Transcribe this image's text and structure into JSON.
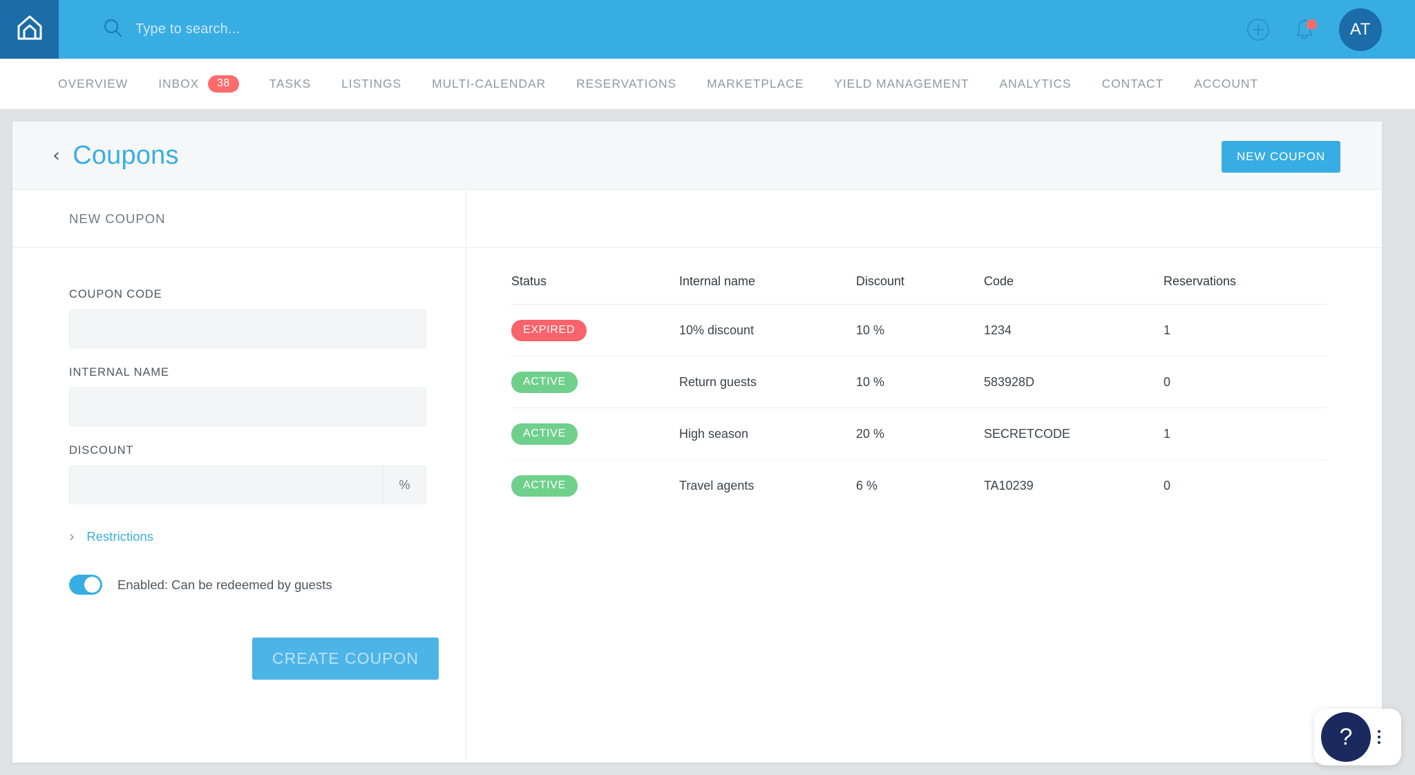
{
  "header": {
    "logo_icon": "house-logo-icon",
    "search": {
      "icon": "search-icon",
      "placeholder": "Type to search...",
      "value": ""
    },
    "add_icon": "plus-circle-icon",
    "notifications_icon": "bell-icon",
    "notifications_has_alert": true,
    "avatar_initials": "AT",
    "bg_color": "#38ade3",
    "logo_bg_color": "#1b6ca8"
  },
  "nav": {
    "items": [
      {
        "label": "OVERVIEW",
        "badge": null
      },
      {
        "label": "INBOX",
        "badge": "38"
      },
      {
        "label": "TASKS",
        "badge": null
      },
      {
        "label": "LISTINGS",
        "badge": null
      },
      {
        "label": "MULTI-CALENDAR",
        "badge": null
      },
      {
        "label": "RESERVATIONS",
        "badge": null
      },
      {
        "label": "MARKETPLACE",
        "badge": null
      },
      {
        "label": "YIELD MANAGEMENT",
        "badge": null
      },
      {
        "label": "ANALYTICS",
        "badge": null
      },
      {
        "label": "CONTACT",
        "badge": null
      },
      {
        "label": "ACCOUNT",
        "badge": null
      }
    ],
    "badge_color": "#ff6b6b"
  },
  "page": {
    "back_icon": "chevron-left-icon",
    "title": "Coupons",
    "title_color": "#3aaee0",
    "new_coupon_button": "NEW COUPON"
  },
  "form": {
    "panel_title": "NEW COUPON",
    "coupon_code": {
      "label": "COUPON CODE",
      "value": "",
      "placeholder": ""
    },
    "internal_name": {
      "label": "INTERNAL NAME",
      "value": "",
      "placeholder": ""
    },
    "discount": {
      "label": "DISCOUNT",
      "value": "",
      "placeholder": "",
      "suffix": "%"
    },
    "restrictions": {
      "label": "Restrictions",
      "icon": "chevron-right-icon",
      "expanded": false
    },
    "toggle": {
      "label": "Enabled: Can be redeemed by guests",
      "state": "on",
      "color": "#38ade3"
    },
    "submit_button": "CREATE COUPON"
  },
  "table": {
    "columns": [
      "Status",
      "Internal name",
      "Discount",
      "Code",
      "Reservations"
    ],
    "rows": [
      {
        "status": "EXPIRED",
        "status_type": "expired",
        "name": "10% discount",
        "discount": "10 %",
        "code": "1234",
        "reservations": "1"
      },
      {
        "status": "ACTIVE",
        "status_type": "active",
        "name": "Return guests",
        "discount": "10 %",
        "code": "583928D",
        "reservations": "0"
      },
      {
        "status": "ACTIVE",
        "status_type": "active",
        "name": "High season",
        "discount": "20 %",
        "code": "SECRETCODE",
        "reservations": "1"
      },
      {
        "status": "ACTIVE",
        "status_type": "active",
        "name": "Travel agents",
        "discount": "6 %",
        "code": "TA10239",
        "reservations": "0"
      }
    ],
    "expired_color": "#f9636b",
    "active_color": "#6fd08c"
  },
  "help_widget": {
    "icon": "question-mark-icon",
    "label": "?",
    "menu_icon": "kebab-menu-icon",
    "color": "#1b2a5e"
  }
}
